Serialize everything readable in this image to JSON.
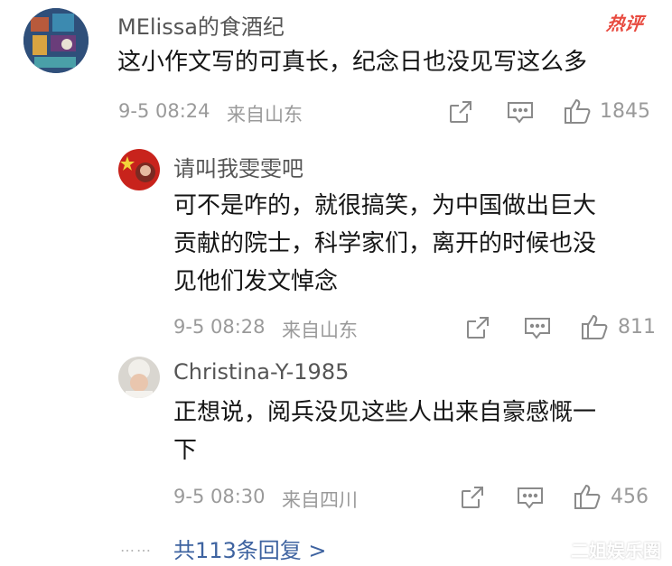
{
  "main_comment": {
    "username": "MElissa的食酒纪",
    "badge": "热评",
    "text": "这小作文写的可真长，纪念日也没见写这么多",
    "timestamp": "9-5 08:24",
    "source": "来自山东",
    "like_count": "1845"
  },
  "replies": [
    {
      "username": "请叫我雯雯吧",
      "text_lines": [
        "可不是咋的，就很搞笑，为中国做出巨大",
        "贡献的院士，科学家们，离开的时候也没",
        "见他们发文悼念"
      ],
      "timestamp": "9-5 08:28",
      "source": "来自山东",
      "like_count": "811"
    },
    {
      "username": "Christina-Y-1985",
      "text_lines": [
        "正想说，阅兵没见这些人出来自豪感慨一",
        "下"
      ],
      "timestamp": "9-5 08:30",
      "source": "来自四川",
      "like_count": "456"
    }
  ],
  "more_replies": {
    "dots": "……",
    "label": "共113条回复 >"
  },
  "watermark": "二姐娱乐圈",
  "icons": [
    "share-icon",
    "comment-icon",
    "like-icon"
  ],
  "colors": {
    "link": "#3e63a0",
    "hot_badge": "#e84a3f",
    "meta": "#9a9a9a"
  }
}
